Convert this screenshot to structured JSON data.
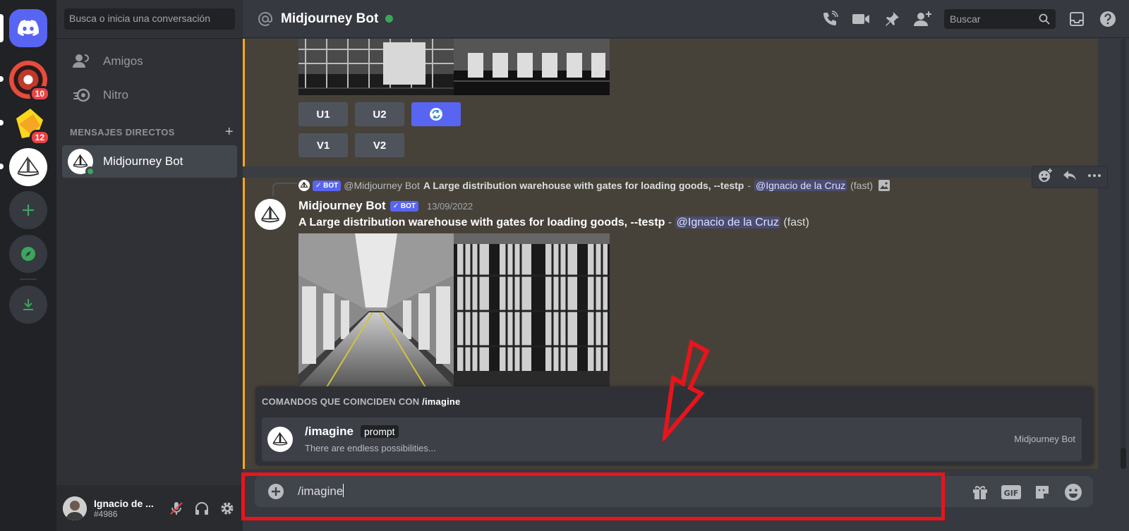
{
  "servers": {
    "home_label": "Inicio",
    "badges": [
      "10",
      "12"
    ]
  },
  "sidebar": {
    "search_placeholder": "Busca o inicia una conversación",
    "nav": [
      {
        "label": "Amigos",
        "icon": "friends-icon"
      },
      {
        "label": "Nitro",
        "icon": "nitro-icon"
      }
    ],
    "dm_header": "MENSAJES DIRECTOS",
    "dm_add": "+",
    "dms": [
      {
        "name": "Midjourney Bot",
        "status": "online"
      }
    ]
  },
  "user": {
    "name": "Ignacio de ...",
    "tag": "#4986"
  },
  "topbar": {
    "channel": "Midjourney Bot",
    "search_placeholder": "Buscar"
  },
  "messages": {
    "buttons_row1": [
      "U1",
      "U2"
    ],
    "buttons_row2": [
      "V1",
      "V2"
    ],
    "reply": {
      "bot_tag": "✓ BOT",
      "author": "@Midjourney Bot",
      "prompt": "A Large distribution warehouse with gates for loading goods, --testp",
      "separator": "-",
      "mention": "@Ignacio de la Cruz",
      "mode": "(fast)"
    },
    "current": {
      "author": "Midjourney Bot",
      "bot_tag": "✓ BOT",
      "timestamp": "13/09/2022",
      "prompt": "A Large distribution warehouse with gates for loading goods, --testp",
      "separator": "-",
      "mention": "@Ignacio de la Cruz",
      "mode": "(fast)"
    }
  },
  "autocomplete": {
    "header_prefix": "COMANDOS QUE COINCIDEN CON",
    "header_query": "/imagine",
    "command": "/imagine",
    "option": "prompt",
    "description": "There are endless possibilities...",
    "source": "Midjourney Bot"
  },
  "composer": {
    "value": "/imagine"
  },
  "colors": {
    "accent": "#5865f2",
    "online": "#3ba55d",
    "highlight_border": "#faa81a",
    "annotation_red": "#e8141c"
  }
}
